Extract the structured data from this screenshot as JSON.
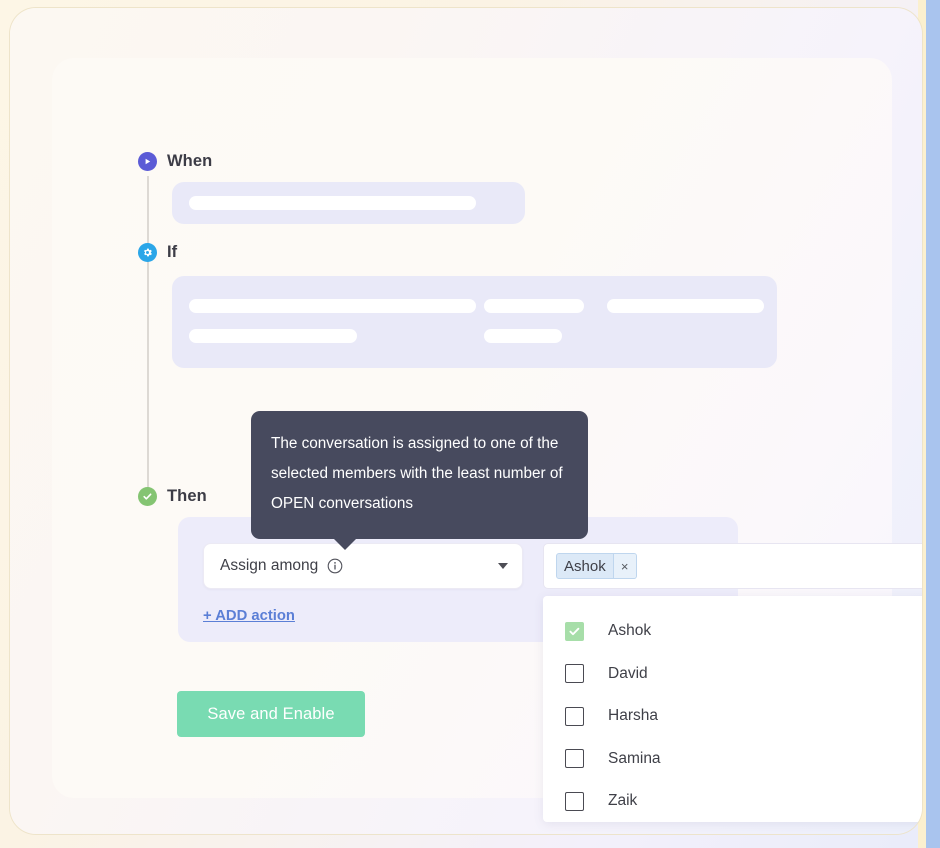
{
  "workflow": {
    "steps": [
      {
        "label": "When",
        "icon": "play-circle-icon",
        "color": "#5b5bd6"
      },
      {
        "label": "If",
        "icon": "gear-circle-icon",
        "color": "#2ba6e8"
      },
      {
        "label": "Then",
        "icon": "check-circle-icon",
        "color": "#84c472"
      }
    ]
  },
  "tooltip": {
    "text": "The conversation is assigned to one of the selected members with the least number of OPEN conversations"
  },
  "action": {
    "select_label": "Assign among",
    "info_icon": "info-icon",
    "caret_icon": "chevron-down-icon",
    "add_action_label": "+ ADD action"
  },
  "save": {
    "label": "Save and Enable",
    "color": "#79dbb2"
  },
  "member_select": {
    "chips": [
      {
        "label": "Ashok",
        "remove_icon": "×"
      }
    ],
    "options": [
      {
        "label": "Ashok",
        "checked": true
      },
      {
        "label": "David",
        "checked": false
      },
      {
        "label": "Harsha",
        "checked": false
      },
      {
        "label": "Samina",
        "checked": false
      },
      {
        "label": "Zaik",
        "checked": false
      }
    ],
    "checked_color": "#a7dea9"
  }
}
